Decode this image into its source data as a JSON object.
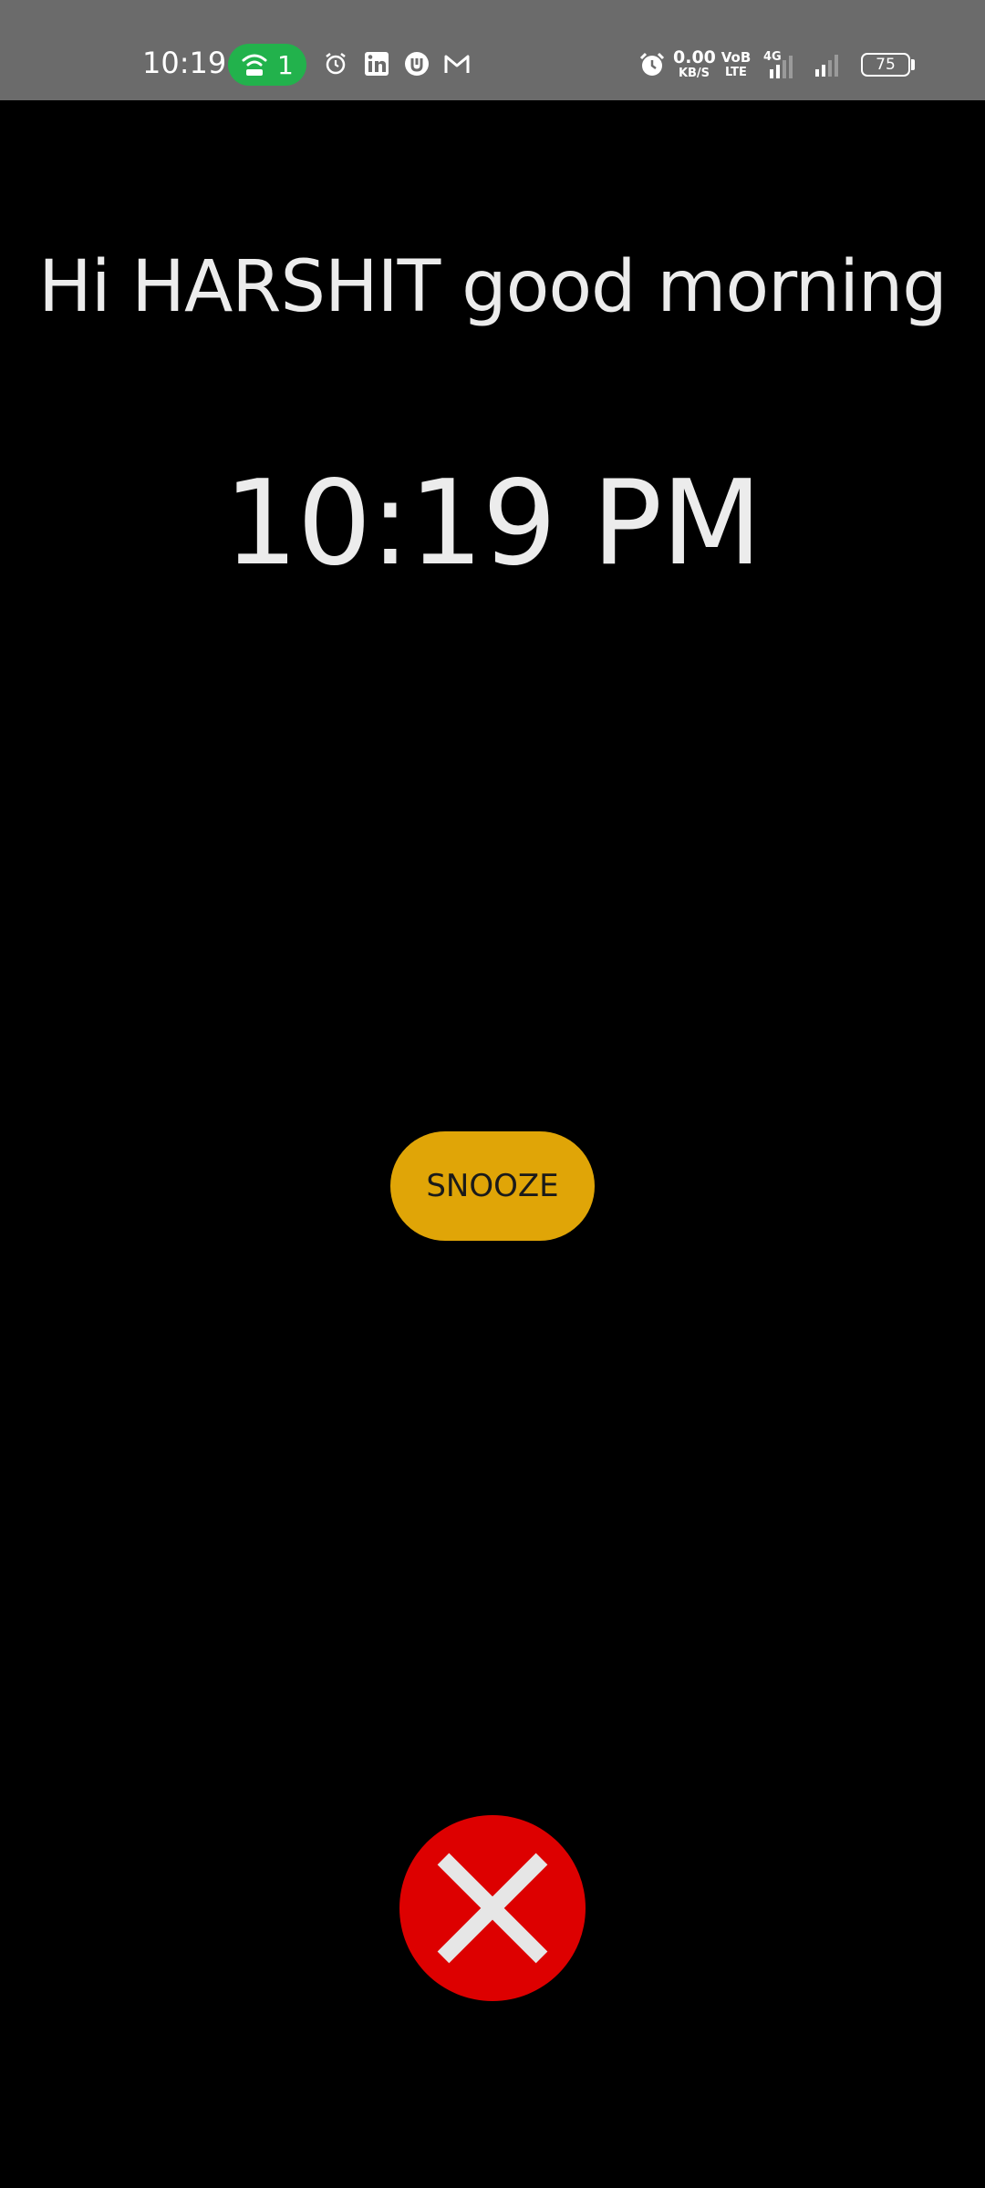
{
  "status_bar": {
    "time": "10:19",
    "hotspot_count": "1",
    "network_speed_value": "0.00",
    "network_speed_unit": "KB/S",
    "volte_top": "VoB",
    "volte_bottom": "LTE",
    "network_type": "4G",
    "battery_level": "75",
    "icons": [
      "hotspot-icon",
      "alarm-icon",
      "linkedin-icon",
      "app-notification-icon",
      "gmail-icon",
      "alarm-icon",
      "signal-icon"
    ]
  },
  "alarm": {
    "greeting": "Hi HARSHIT good morning",
    "time": "10:19 PM",
    "snooze_label": "SNOOZE",
    "dismiss_icon": "close-icon"
  },
  "colors": {
    "background": "#000000",
    "status_bar": "#6b6b6b",
    "hotspot_pill": "#22b24c",
    "snooze": "#e0a507",
    "dismiss": "#dd0000",
    "text": "#ececec"
  }
}
